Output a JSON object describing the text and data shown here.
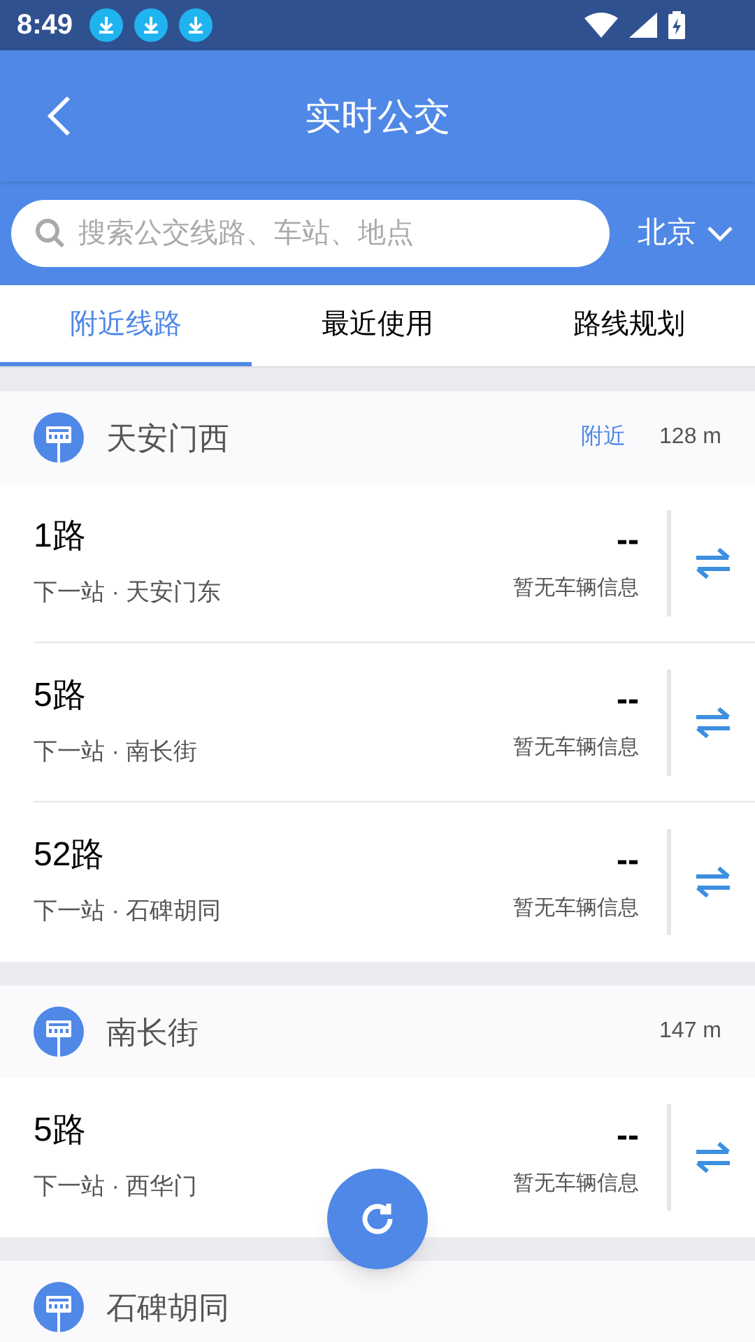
{
  "status_bar": {
    "time": "8:49",
    "notifications": [
      {
        "kind": "download"
      },
      {
        "kind": "download"
      },
      {
        "kind": "download"
      }
    ]
  },
  "header": {
    "title": "实时公交"
  },
  "search": {
    "placeholder": "搜索公交线路、车站、地点",
    "city": "北京"
  },
  "tabs": [
    {
      "label": "附近线路",
      "selected": true
    },
    {
      "label": "最近使用",
      "selected": false
    },
    {
      "label": "路线规划",
      "selected": false
    }
  ],
  "stations": [
    {
      "name": "天安门西",
      "tag": "附近",
      "distance": "128 m",
      "routes": [
        {
          "name": "1路",
          "next_stop": "下一站 · 天安门东",
          "eta": "--",
          "info": "暂无车辆信息"
        },
        {
          "name": "5路",
          "next_stop": "下一站 · 南长街",
          "eta": "--",
          "info": "暂无车辆信息"
        },
        {
          "name": "52路",
          "next_stop": "下一站 · 石碑胡同",
          "eta": "--",
          "info": "暂无车辆信息"
        }
      ]
    },
    {
      "name": "南长街",
      "distance": "147 m",
      "routes": [
        {
          "name": "5路",
          "next_stop": "下一站 · 西华门",
          "eta": "--",
          "info": "暂无车辆信息"
        }
      ]
    },
    {
      "name": "石碑胡同"
    }
  ]
}
